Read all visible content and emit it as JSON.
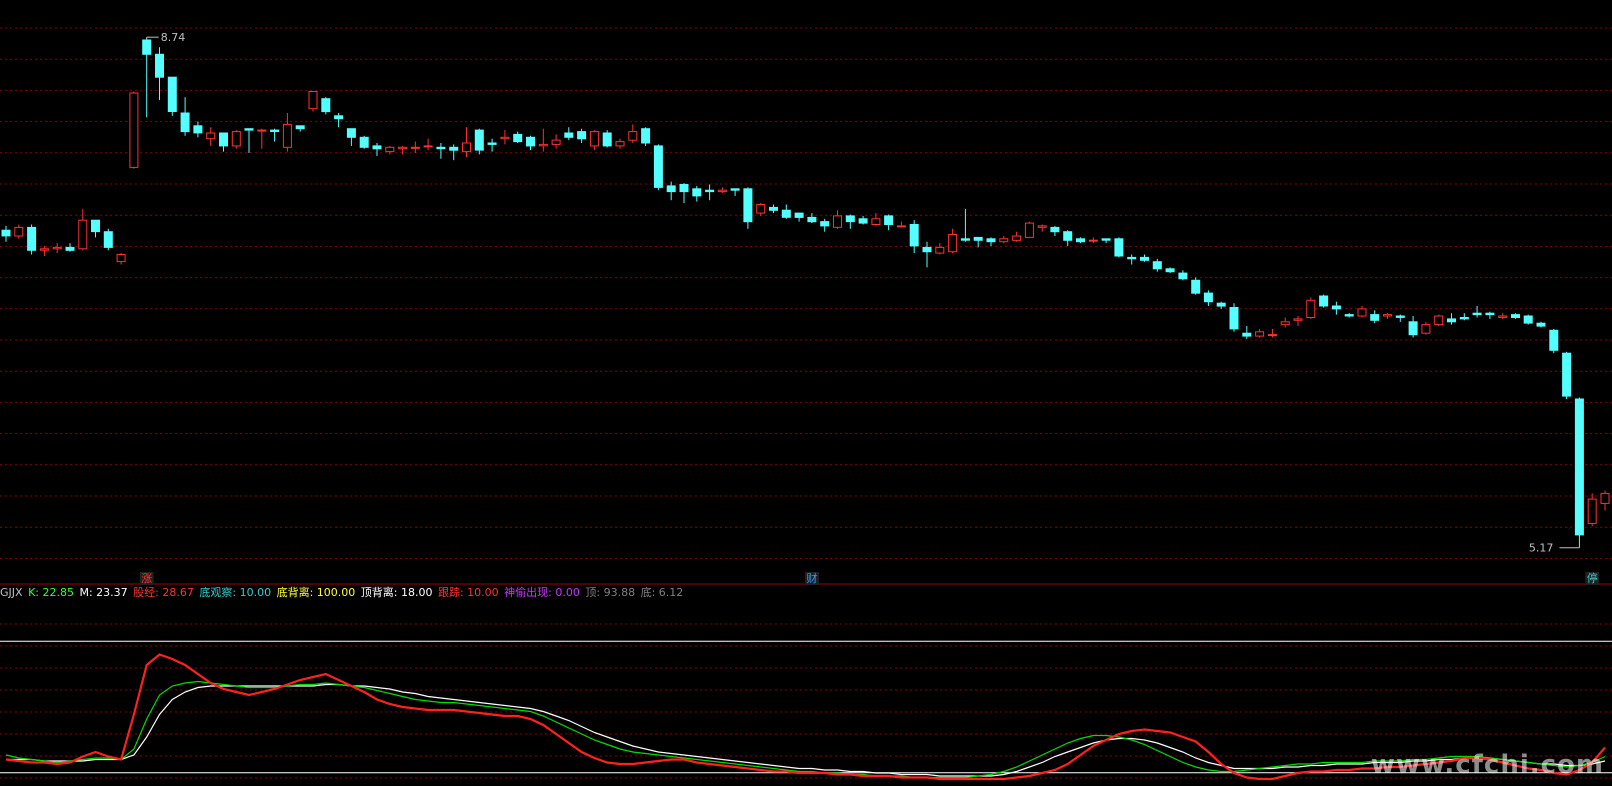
{
  "chart_data": {
    "type": "candlestick",
    "symbol_panel": {
      "y_range": [
        5.0,
        9.0
      ],
      "high_label": "8.74",
      "low_label": "5.17",
      "markers": [
        {
          "index": 11,
          "text": "涨",
          "color": "#ff3333"
        },
        {
          "index": 63,
          "text": "财",
          "color": "#3399ff"
        },
        {
          "index": 124,
          "text": "停",
          "color": "#33cccc"
        }
      ],
      "candles": [
        [
          7.39,
          7.42,
          7.31,
          7.35
        ],
        [
          7.35,
          7.43,
          7.33,
          7.41
        ],
        [
          7.41,
          7.43,
          7.22,
          7.25
        ],
        [
          7.25,
          7.28,
          7.21,
          7.26
        ],
        [
          7.26,
          7.3,
          7.23,
          7.27
        ],
        [
          7.27,
          7.3,
          7.24,
          7.25
        ],
        [
          7.26,
          7.54,
          7.25,
          7.46
        ],
        [
          7.46,
          7.46,
          7.34,
          7.38
        ],
        [
          7.38,
          7.4,
          7.25,
          7.27
        ],
        [
          7.17,
          7.23,
          7.15,
          7.22
        ],
        [
          7.83,
          8.36,
          7.82,
          8.35
        ],
        [
          8.72,
          8.74,
          8.18,
          8.62
        ],
        [
          8.62,
          8.67,
          8.3,
          8.46
        ],
        [
          8.46,
          8.46,
          8.19,
          8.22
        ],
        [
          8.21,
          8.32,
          8.05,
          8.08
        ],
        [
          8.12,
          8.15,
          8.04,
          8.07
        ],
        [
          8.03,
          8.11,
          7.98,
          8.07
        ],
        [
          8.07,
          8.07,
          7.94,
          7.98
        ],
        [
          7.98,
          8.09,
          7.96,
          8.08
        ],
        [
          8.1,
          8.1,
          7.93,
          8.09
        ],
        [
          8.09,
          8.1,
          7.96,
          8.09
        ],
        [
          8.09,
          8.1,
          8.01,
          8.08
        ],
        [
          7.97,
          8.21,
          7.94,
          8.13
        ],
        [
          8.12,
          8.12,
          8.08,
          8.1
        ],
        [
          8.24,
          8.36,
          8.22,
          8.36
        ],
        [
          8.31,
          8.32,
          8.2,
          8.22
        ],
        [
          8.19,
          8.21,
          8.11,
          8.17
        ],
        [
          8.1,
          8.1,
          7.98,
          8.04
        ],
        [
          8.04,
          8.05,
          7.96,
          7.97
        ],
        [
          7.98,
          8.0,
          7.91,
          7.96
        ],
        [
          7.94,
          7.98,
          7.92,
          7.97
        ],
        [
          7.96,
          7.98,
          7.92,
          7.97
        ],
        [
          7.97,
          8.01,
          7.93,
          7.97
        ],
        [
          7.98,
          8.03,
          7.95,
          7.98
        ],
        [
          7.97,
          8.0,
          7.89,
          7.96
        ],
        [
          7.97,
          7.99,
          7.88,
          7.95
        ],
        [
          7.94,
          8.11,
          7.9,
          8.0
        ],
        [
          8.09,
          8.1,
          7.92,
          7.95
        ],
        [
          8.0,
          8.03,
          7.94,
          7.99
        ],
        [
          8.03,
          8.09,
          7.99,
          8.04
        ],
        [
          8.06,
          8.08,
          8.0,
          8.01
        ],
        [
          8.04,
          8.05,
          7.95,
          7.98
        ],
        [
          7.98,
          8.1,
          7.94,
          7.99
        ],
        [
          7.99,
          8.06,
          7.96,
          8.02
        ],
        [
          8.07,
          8.11,
          8.02,
          8.04
        ],
        [
          8.08,
          8.1,
          8.0,
          8.03
        ],
        [
          7.98,
          8.09,
          7.95,
          8.08
        ],
        [
          8.07,
          8.09,
          7.97,
          7.98
        ],
        [
          7.98,
          8.03,
          7.96,
          8.01
        ],
        [
          8.02,
          8.13,
          8.0,
          8.08
        ],
        [
          8.1,
          8.11,
          7.98,
          8.0
        ],
        [
          7.98,
          7.99,
          7.67,
          7.69
        ],
        [
          7.7,
          7.73,
          7.6,
          7.66
        ],
        [
          7.71,
          7.72,
          7.58,
          7.66
        ],
        [
          7.68,
          7.7,
          7.59,
          7.63
        ],
        [
          7.67,
          7.71,
          7.6,
          7.66
        ],
        [
          7.66,
          7.69,
          7.65,
          7.67
        ],
        [
          7.68,
          7.68,
          7.63,
          7.67
        ],
        [
          7.68,
          7.69,
          7.4,
          7.45
        ],
        [
          7.51,
          7.58,
          7.49,
          7.57
        ],
        [
          7.55,
          7.57,
          7.51,
          7.53
        ],
        [
          7.53,
          7.57,
          7.47,
          7.48
        ],
        [
          7.51,
          7.51,
          7.45,
          7.48
        ],
        [
          7.48,
          7.51,
          7.44,
          7.45
        ],
        [
          7.45,
          7.47,
          7.38,
          7.42
        ],
        [
          7.41,
          7.53,
          7.4,
          7.49
        ],
        [
          7.49,
          7.5,
          7.4,
          7.45
        ],
        [
          7.47,
          7.49,
          7.43,
          7.44
        ],
        [
          7.43,
          7.51,
          7.42,
          7.47
        ],
        [
          7.49,
          7.5,
          7.39,
          7.43
        ],
        [
          7.42,
          7.45,
          7.41,
          7.42
        ],
        [
          7.43,
          7.46,
          7.23,
          7.28
        ],
        [
          7.27,
          7.31,
          7.13,
          7.24
        ],
        [
          7.23,
          7.3,
          7.22,
          7.27
        ],
        [
          7.24,
          7.4,
          7.23,
          7.36
        ],
        [
          7.33,
          7.54,
          7.31,
          7.32
        ],
        [
          7.34,
          7.34,
          7.27,
          7.32
        ],
        [
          7.33,
          7.34,
          7.28,
          7.31
        ],
        [
          7.31,
          7.35,
          7.3,
          7.33
        ],
        [
          7.32,
          7.38,
          7.31,
          7.35
        ],
        [
          7.34,
          7.45,
          7.34,
          7.44
        ],
        [
          7.41,
          7.43,
          7.38,
          7.42
        ],
        [
          7.41,
          7.42,
          7.35,
          7.38
        ],
        [
          7.38,
          7.39,
          7.28,
          7.32
        ],
        [
          7.33,
          7.34,
          7.3,
          7.31
        ],
        [
          7.32,
          7.34,
          7.3,
          7.32
        ],
        [
          7.33,
          7.33,
          7.3,
          7.32
        ],
        [
          7.33,
          7.34,
          7.2,
          7.21
        ],
        [
          7.2,
          7.22,
          7.15,
          7.19
        ],
        [
          7.2,
          7.22,
          7.17,
          7.18
        ],
        [
          7.17,
          7.19,
          7.1,
          7.12
        ],
        [
          7.12,
          7.13,
          7.09,
          7.1
        ],
        [
          7.09,
          7.11,
          7.04,
          7.05
        ],
        [
          7.04,
          7.06,
          6.94,
          6.95
        ],
        [
          6.95,
          6.97,
          6.86,
          6.89
        ],
        [
          6.88,
          6.89,
          6.84,
          6.86
        ],
        [
          6.85,
          6.88,
          6.68,
          6.7
        ],
        [
          6.67,
          6.72,
          6.63,
          6.65
        ],
        [
          6.65,
          6.7,
          6.64,
          6.68
        ],
        [
          6.66,
          6.7,
          6.64,
          6.66
        ],
        [
          6.73,
          6.78,
          6.71,
          6.75
        ],
        [
          6.76,
          6.79,
          6.72,
          6.77
        ],
        [
          6.78,
          6.92,
          6.77,
          6.9
        ],
        [
          6.93,
          6.94,
          6.85,
          6.86
        ],
        [
          6.86,
          6.89,
          6.8,
          6.84
        ],
        [
          6.8,
          6.81,
          6.78,
          6.79
        ],
        [
          6.79,
          6.86,
          6.78,
          6.84
        ],
        [
          6.8,
          6.83,
          6.74,
          6.76
        ],
        [
          6.79,
          6.81,
          6.77,
          6.8
        ],
        [
          6.79,
          6.8,
          6.75,
          6.78
        ],
        [
          6.75,
          6.79,
          6.64,
          6.66
        ],
        [
          6.67,
          6.75,
          6.66,
          6.73
        ],
        [
          6.73,
          6.8,
          6.72,
          6.79
        ],
        [
          6.77,
          6.81,
          6.73,
          6.75
        ],
        [
          6.78,
          6.81,
          6.76,
          6.77
        ],
        [
          6.81,
          6.86,
          6.78,
          6.8
        ],
        [
          6.81,
          6.82,
          6.77,
          6.8
        ],
        [
          6.78,
          6.81,
          6.77,
          6.79
        ],
        [
          6.8,
          6.81,
          6.77,
          6.78
        ],
        [
          6.79,
          6.8,
          6.73,
          6.74
        ],
        [
          6.74,
          6.75,
          6.71,
          6.72
        ],
        [
          6.69,
          6.7,
          6.53,
          6.55
        ],
        [
          6.53,
          6.54,
          6.21,
          6.23
        ],
        [
          6.21,
          6.22,
          5.17,
          5.26
        ],
        [
          5.34,
          5.55,
          5.32,
          5.51
        ],
        [
          5.48,
          5.57,
          5.43,
          5.55
        ]
      ]
    },
    "indicator_panel": {
      "name": "GJJX",
      "legend": [
        {
          "label": "K:",
          "value": "22.85",
          "color": "#33ff33"
        },
        {
          "label": "M:",
          "value": "23.37",
          "color": "#ffffff"
        },
        {
          "label": "股经:",
          "value": "28.67",
          "color": "#ff3333"
        },
        {
          "label": "底观察:",
          "value": "10.00",
          "color": "#33cccc"
        },
        {
          "label": "底背离:",
          "value": "100.00",
          "color": "#ffff33"
        },
        {
          "label": "顶背离:",
          "value": "18.00",
          "color": "#ffffff"
        },
        {
          "label": "跟踪:",
          "value": "10.00",
          "color": "#ff3333"
        },
        {
          "label": "神偷出现:",
          "value": "0.00",
          "color": "#cc33ff"
        },
        {
          "label": "顶:",
          "value": "93.88",
          "color": "#808080"
        },
        {
          "label": "底:",
          "value": "6.12",
          "color": "#808080"
        }
      ],
      "y_range": [
        0,
        120
      ],
      "reference_levels": [
        93.88,
        6.12
      ],
      "guzheng": [
        15,
        14,
        13,
        13,
        12,
        13,
        17,
        20,
        17,
        15,
        45,
        78,
        85,
        82,
        78,
        72,
        66,
        62,
        60,
        58,
        60,
        62,
        65,
        68,
        70,
        72,
        68,
        64,
        60,
        55,
        52,
        50,
        49,
        48,
        48,
        48,
        47,
        46,
        45,
        44,
        44,
        42,
        38,
        32,
        26,
        20,
        16,
        13,
        12,
        12,
        13,
        14,
        15,
        15,
        13,
        12,
        11,
        10,
        9,
        8,
        7,
        7,
        6,
        6,
        6,
        5,
        5,
        4,
        4,
        4,
        3,
        3,
        3,
        2,
        2,
        2,
        2,
        2,
        2,
        3,
        4,
        6,
        8,
        12,
        18,
        24,
        28,
        32,
        34,
        35,
        34,
        33,
        30,
        27,
        20,
        12,
        6,
        3,
        2,
        2,
        4,
        6,
        7,
        7,
        8,
        8,
        9,
        9,
        10,
        10,
        11,
        12,
        13,
        14,
        16,
        16,
        15,
        13,
        11,
        9,
        8,
        6,
        5,
        8,
        13,
        23
      ],
      "k_line": [
        18,
        16,
        15,
        14,
        13,
        14,
        15,
        16,
        16,
        15,
        22,
        42,
        58,
        64,
        66,
        67,
        66,
        65,
        64,
        63,
        63,
        63,
        64,
        65,
        65,
        66,
        65,
        64,
        63,
        61,
        59,
        57,
        55,
        54,
        53,
        53,
        52,
        51,
        50,
        49,
        48,
        47,
        44,
        40,
        36,
        32,
        28,
        25,
        22,
        20,
        19,
        18,
        17,
        16,
        15,
        14,
        13,
        12,
        11,
        10,
        9,
        8,
        7,
        7,
        6,
        6,
        5,
        5,
        4,
        4,
        4,
        3,
        3,
        3,
        3,
        3,
        4,
        5,
        7,
        10,
        14,
        18,
        22,
        26,
        29,
        31,
        31,
        30,
        28,
        25,
        21,
        17,
        13,
        10,
        8,
        7,
        7,
        8,
        9,
        10,
        11,
        12,
        12,
        13,
        13,
        13,
        13,
        14,
        14,
        14,
        15,
        15,
        16,
        17,
        17,
        17,
        16,
        15,
        14,
        13,
        12,
        11,
        10,
        11,
        13,
        17
      ],
      "m_line": [
        15,
        15,
        15,
        14,
        14,
        14,
        14,
        15,
        15,
        15,
        18,
        30,
        45,
        55,
        60,
        63,
        64,
        64,
        64,
        64,
        64,
        64,
        64,
        64,
        64,
        65,
        65,
        64,
        64,
        63,
        62,
        60,
        59,
        57,
        56,
        55,
        54,
        53,
        52,
        51,
        50,
        49,
        47,
        44,
        41,
        37,
        33,
        30,
        27,
        24,
        22,
        20,
        19,
        18,
        17,
        16,
        15,
        14,
        13,
        12,
        11,
        10,
        9,
        9,
        8,
        8,
        7,
        7,
        6,
        6,
        5,
        5,
        5,
        4,
        4,
        4,
        4,
        4,
        5,
        7,
        10,
        13,
        17,
        20,
        23,
        26,
        28,
        29,
        29,
        28,
        26,
        23,
        20,
        16,
        13,
        11,
        9,
        9,
        9,
        9,
        10,
        10,
        11,
        11,
        12,
        12,
        12,
        13,
        13,
        13,
        14,
        14,
        15,
        15,
        16,
        16,
        16,
        15,
        14,
        13,
        12,
        12,
        11,
        11,
        12,
        14
      ]
    }
  },
  "watermark": "www.cfchi.com"
}
